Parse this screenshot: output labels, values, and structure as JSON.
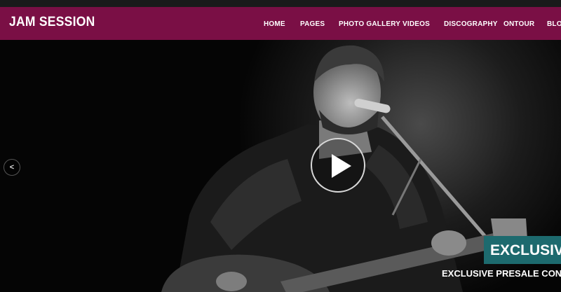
{
  "brand": {
    "name": "JAM SESSION"
  },
  "nav": {
    "items": [
      {
        "label": "HOME"
      },
      {
        "label": "PAGES"
      },
      {
        "label": "PHOTO GALLERY"
      },
      {
        "label": "VIDEOS"
      },
      {
        "label": "DISCOGRAPHY"
      },
      {
        "label": "ONTOUR"
      },
      {
        "label": "BLOG"
      }
    ]
  },
  "slider": {
    "prev_label": "<",
    "caption_title": "EXCLUSIVE T",
    "caption_subtitle": "EXCLUSIVE PRESALE CONCERT T"
  },
  "colors": {
    "navbar": "#7a0f45",
    "caption_bg": "#1d6a6e"
  }
}
